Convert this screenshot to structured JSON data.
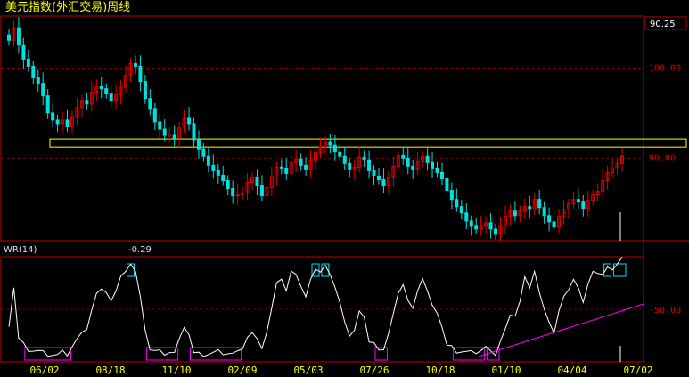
{
  "window": {
    "title": "美元指数(外汇交易)周线"
  },
  "price_box": {
    "value": "90.25"
  },
  "indicator": {
    "name": "WR(14)",
    "value": "-0.29"
  },
  "colors": {
    "background": "#000000",
    "up": "#e00000",
    "down": "#00e0e0",
    "frame": "#c00000",
    "grid": "#800000",
    "band": "#ffff00",
    "wr_line": "#ffffff",
    "top_box": "#00e0ff",
    "bottom_box": "#ff00ff",
    "trend_line": "#ff00ff",
    "date_text": "#ffff00",
    "title_text": "#ffff00"
  },
  "chart_data": [
    {
      "type": "candlestick",
      "title": "美元指数(外汇交易)周线",
      "y_ticks": [
        "100.00",
        "90.00"
      ],
      "y_tick_values": [
        100,
        90
      ],
      "ylim": [
        80.8,
        105.8
      ],
      "x_tick_labels": [
        "06/02",
        "08/18",
        "11/10",
        "02/09",
        "05/03",
        "07/26",
        "10/18",
        "01/10",
        "04/04",
        "07/02"
      ],
      "highlight_band": [
        91.2,
        92.1
      ],
      "last_value": 90.25,
      "closes": [
        103.1,
        104.5,
        102.6,
        101.0,
        100.2,
        99.0,
        98.3,
        96.9,
        95.0,
        94.2,
        93.8,
        94.2,
        93.5,
        94.6,
        95.6,
        96.4,
        96.0,
        97.3,
        98.0,
        97.7,
        97.2,
        96.4,
        97.0,
        97.9,
        99.2,
        100.5,
        100.2,
        98.5,
        96.6,
        95.5,
        94.0,
        93.2,
        92.5,
        92.6,
        92.2,
        93.4,
        94.5,
        93.8,
        92.0,
        91.0,
        90.2,
        89.2,
        88.6,
        88.1,
        87.5,
        86.6,
        85.8,
        85.9,
        86.1,
        87.3,
        87.8,
        86.9,
        85.8,
        86.7,
        88.0,
        89.0,
        88.8,
        88.3,
        89.5,
        89.9,
        89.2,
        88.7,
        89.7,
        90.6,
        91.2,
        91.8,
        91.4,
        90.7,
        90.2,
        89.4,
        88.7,
        89.0,
        90.1,
        89.8,
        88.6,
        88.0,
        87.6,
        86.9,
        87.8,
        89.1,
        90.3,
        90.0,
        89.1,
        88.7,
        89.6,
        90.2,
        89.5,
        88.8,
        88.4,
        87.7,
        86.4,
        85.4,
        84.6,
        83.9,
        83.0,
        82.4,
        82.1,
        82.4,
        82.8,
        82.1,
        81.5,
        82.5,
        83.5,
        84.1,
        83.6,
        84.1,
        84.6,
        84.3,
        85.4,
        84.5,
        83.6,
        82.9,
        82.3,
        83.5,
        84.3,
        84.9,
        85.4,
        85.1,
        84.4,
        85.3,
        85.9,
        86.3,
        87.5,
        88.4,
        88.9,
        89.4,
        90.25
      ],
      "indicator_name": "WR(14)",
      "indicator_value": -0.29,
      "indicator_ticks": [
        "-50.00"
      ],
      "indicator_ylim": [
        0,
        -100
      ],
      "indicator_x_tick_labels": [
        "06/02",
        "08/18",
        "11/10",
        "02/09",
        "05/03",
        "07/26",
        "10/18",
        "01/10",
        "04/04",
        "07/02"
      ]
    }
  ]
}
